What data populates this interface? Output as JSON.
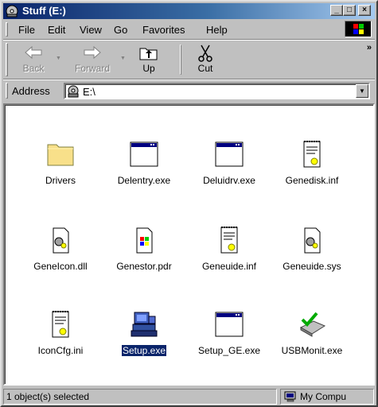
{
  "window": {
    "title": "Stuff (E:)"
  },
  "title_buttons": {
    "minimize": "_",
    "maximize": "□",
    "close": "×"
  },
  "menu": {
    "items": [
      {
        "label": "File"
      },
      {
        "label": "Edit"
      },
      {
        "label": "View"
      },
      {
        "label": "Go"
      },
      {
        "label": "Favorites"
      },
      {
        "label": "Help"
      }
    ]
  },
  "toolbar": {
    "back": "Back",
    "forward": "Forward",
    "up": "Up",
    "cut": "Cut",
    "more": "»"
  },
  "address": {
    "label": "Address",
    "value": "E:\\"
  },
  "files": [
    {
      "name": "Drivers",
      "icon": "folder-icon"
    },
    {
      "name": "Delentry.exe",
      "icon": "program-window-icon"
    },
    {
      "name": "Deluidrv.exe",
      "icon": "program-window-icon"
    },
    {
      "name": "Genedisk.inf",
      "icon": "config-file-icon"
    },
    {
      "name": "GeneIcon.dll",
      "icon": "system-file-icon"
    },
    {
      "name": "Genestor.pdr",
      "icon": "windows-file-icon"
    },
    {
      "name": "Geneuide.inf",
      "icon": "config-file-icon"
    },
    {
      "name": "Geneuide.sys",
      "icon": "system-file-icon"
    },
    {
      "name": "IconCfg.ini",
      "icon": "config-file-icon"
    },
    {
      "name": "Setup.exe",
      "icon": "setup-computer-icon",
      "selected": true
    },
    {
      "name": "Setup_GE.exe",
      "icon": "program-window-icon"
    },
    {
      "name": "USBMonit.exe",
      "icon": "usb-monitor-icon"
    }
  ],
  "status": {
    "left": "1 object(s) selected",
    "right": "My Compu"
  },
  "colors": {
    "titlebar_start": "#0a246a",
    "titlebar_end": "#a6caf0",
    "selection": "#0a246a",
    "chrome": "#c0c0c0"
  }
}
